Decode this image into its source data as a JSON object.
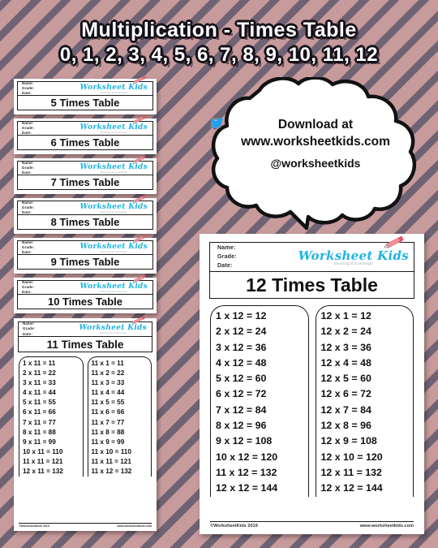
{
  "title": {
    "line1": "Multiplication - Times Table",
    "line2": "0, 1, 2, 3, 4, 5, 6, 7, 8, 9, 10, 11, 12"
  },
  "colors": {
    "background": "#c79a9c",
    "stripe": "#6f6373",
    "logo": "#1eb4e4",
    "facebook": "#3b5998",
    "pinterest": "#e60023",
    "instagram": "#8e8e93",
    "twitter": "#1da1f2",
    "pencil": "#e8717d"
  },
  "worksheet_common": {
    "name_label": "Name:",
    "grade_label": "Grade:",
    "date_label": "Date:",
    "logo_main": "Worksheet Kids",
    "logo_sub": "Sharing Knowledge",
    "copyright": "©WorksheetKids 2019",
    "website": "www.worksheetkids.com"
  },
  "mini_cards": [
    {
      "title": "5 Times Table"
    },
    {
      "title": "6 Times Table"
    },
    {
      "title": "7 Times Table"
    },
    {
      "title": "8 Times Table"
    },
    {
      "title": "9 Times Table"
    },
    {
      "title": "10 Times Table"
    }
  ],
  "card11": {
    "title": "11 Times Table",
    "left_column": [
      "1 x 11 = 11",
      "2 x 11 = 22",
      "3 x 11 = 33",
      "4 x 11 = 44",
      "5 x 11 = 55",
      "6 x 11 = 66",
      "7 x 11 = 77",
      "8 x 11 = 88",
      "9 x 11 = 99",
      "10 x 11 = 110",
      "11 x 11 = 121",
      "12 x 11 = 132"
    ],
    "right_column": [
      "11 x 1 = 11",
      "11 x 2 = 22",
      "11 x 3 = 33",
      "11 x 4 = 44",
      "11 x 5 = 55",
      "11 x 6 = 66",
      "11 x 7 = 77",
      "11 x 8 = 88",
      "11 x 9 = 99",
      "11 x 10 = 110",
      "11 x 11 = 121",
      "11 x 12 = 132"
    ]
  },
  "card12": {
    "title": "12 Times Table",
    "left_column": [
      "1 x 12 = 12",
      "2 x 12 = 24",
      "3 x 12 = 36",
      "4 x 12 = 48",
      "5 x 12 = 60",
      "6 x 12 = 72",
      "7 x 12 = 84",
      "8 x 12 = 96",
      "9 x 12 = 108",
      "10 x 12 = 120",
      "11 x 12 = 132",
      "12 x 12 = 144"
    ],
    "right_column": [
      "12 x 1 = 12",
      "12 x 2 = 24",
      "12 x 3 = 36",
      "12 x 4 = 48",
      "12 x 5 = 60",
      "12 x 6 = 72",
      "12 x 7 = 84",
      "12 x 8 = 96",
      "12 x 9 = 108",
      "12 x 10 = 120",
      "12 x 11 = 132",
      "12 x 12 = 144"
    ]
  },
  "bubble": {
    "download_label": "Download at",
    "url": "www.worksheetkids.com",
    "handle": "@worksheetkids",
    "social_icons": [
      "facebook-icon",
      "pinterest-icon",
      "instagram-icon",
      "twitter-icon"
    ]
  }
}
